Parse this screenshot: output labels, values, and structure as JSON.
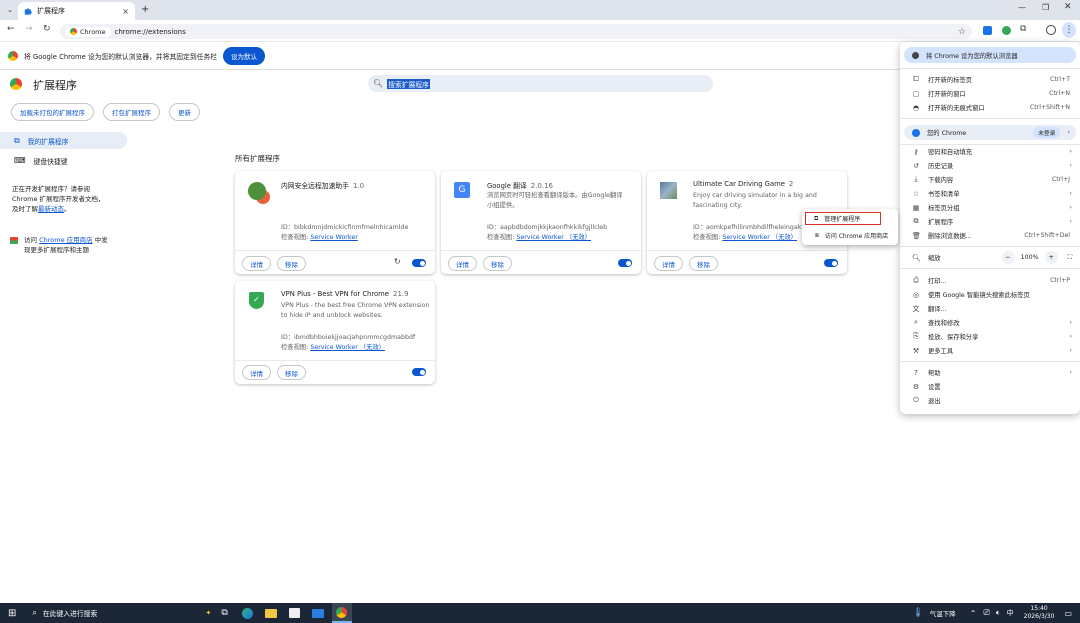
{
  "tab": {
    "title": "扩展程序"
  },
  "toolbar": {
    "chrome_chip": "Chrome",
    "url": "chrome://extensions"
  },
  "infobar": {
    "text": "将 Google Chrome 设为您的默认浏览器，并将其固定到任务栏",
    "button": "设为默认"
  },
  "page": {
    "title": "扩展程序",
    "search_text": "搜索扩展程序"
  },
  "actions": {
    "load": "加载未打包的扩展程序",
    "pack": "打包扩展程序",
    "update": "更新"
  },
  "nav": {
    "my_extensions": "我的扩展程序",
    "shortcuts": "键盘快捷键",
    "dev_text_1": "正在开发扩展程序？请参阅",
    "dev_text_2": "Chrome 扩展程序开发者文档，",
    "dev_text_3": "及时了解",
    "dev_link": "最新动态",
    "dev_text_4": "。",
    "store_pre": "访问",
    "store_link": "Chrome 应用商店",
    "store_post": "中发",
    "store_line2": "现更多扩展程序和主题"
  },
  "section_title": "所有扩展程序",
  "card_labels": {
    "details": "详情",
    "remove": "移除",
    "inspect": "检查视图:"
  },
  "extensions": [
    {
      "name": "内网安全远程加速助手",
      "version": "1.0",
      "desc1": "",
      "desc2": "",
      "id": "ID：bibkdmnjdmickicfinmfmelnhicamlde",
      "view": "Service Worker",
      "enabled": true
    },
    {
      "name": "Google 翻译",
      "version": "2.0.16",
      "desc1": "浏览网页时可轻松查看翻译版本。由Google翻译",
      "desc2": "小组提供。",
      "id": "ID：aapbdbdomjkkjkaonfhkkikfgjllcleb",
      "view": "Service Worker （无效）",
      "enabled": true
    },
    {
      "name": "Ultimate Car Driving Game",
      "version": "2",
      "desc1": "Enjoy car driving simulator in a big and",
      "desc2": "fascinating city.",
      "id": "ID：aomkpefhllinmbhdilfheleingakbb",
      "view": "Service Worker （无效）",
      "enabled": true
    },
    {
      "name": "VPN Plus - Best VPN for Chrome",
      "version": "21.9",
      "desc1": "VPN Plus - the best free Chrome VPN extension",
      "desc2": "to hide IP and unblock websites.",
      "id": "ID：ibmdbhboiekjjoacjahpnmmcgdmabbdf",
      "view": "Service Worker （无效）",
      "enabled": true
    }
  ],
  "menu": {
    "default_banner": "将 Chrome 设为您的默认浏览器",
    "new_tab": "打开新的标签页",
    "new_tab_sc": "Ctrl+T",
    "new_window": "打开新的窗口",
    "new_window_sc": "Ctrl+N",
    "incognito": "打开新的无痕式窗口",
    "incognito_sc": "Ctrl+Shift+N",
    "profile": "您的 Chrome",
    "profile_badge": "未登录",
    "passwords": "密码和自动填充",
    "history": "历史记录",
    "downloads": "下载内容",
    "downloads_sc": "Ctrl+J",
    "bookmarks": "书签和清单",
    "tab_groups": "标签页分组",
    "extensions": "扩展程序",
    "clear": "删除浏览数据...",
    "clear_sc": "Ctrl+Shift+Del",
    "zoom": "缩放",
    "zoom_minus": "−",
    "zoom_value": "100%",
    "zoom_plus": "+",
    "print": "打印...",
    "print_sc": "Ctrl+P",
    "lens": "使用 Google 智能镜头搜索此标签页",
    "translate": "翻译...",
    "find": "查找和修改",
    "cast": "投放、保存和分享",
    "more_tools": "更多工具",
    "help": "帮助",
    "settings": "设置",
    "exit": "退出"
  },
  "submenu": {
    "manage": "管理扩展程序",
    "store": "访问 Chrome 应用商店"
  },
  "taskbar": {
    "search": "在此键入进行搜索",
    "weather": "气温下降",
    "ime": "中",
    "time": "15:40",
    "date": "2026/3/30"
  },
  "colors": {
    "accent": "#0b57d0",
    "highlight_box": "#d93025"
  }
}
